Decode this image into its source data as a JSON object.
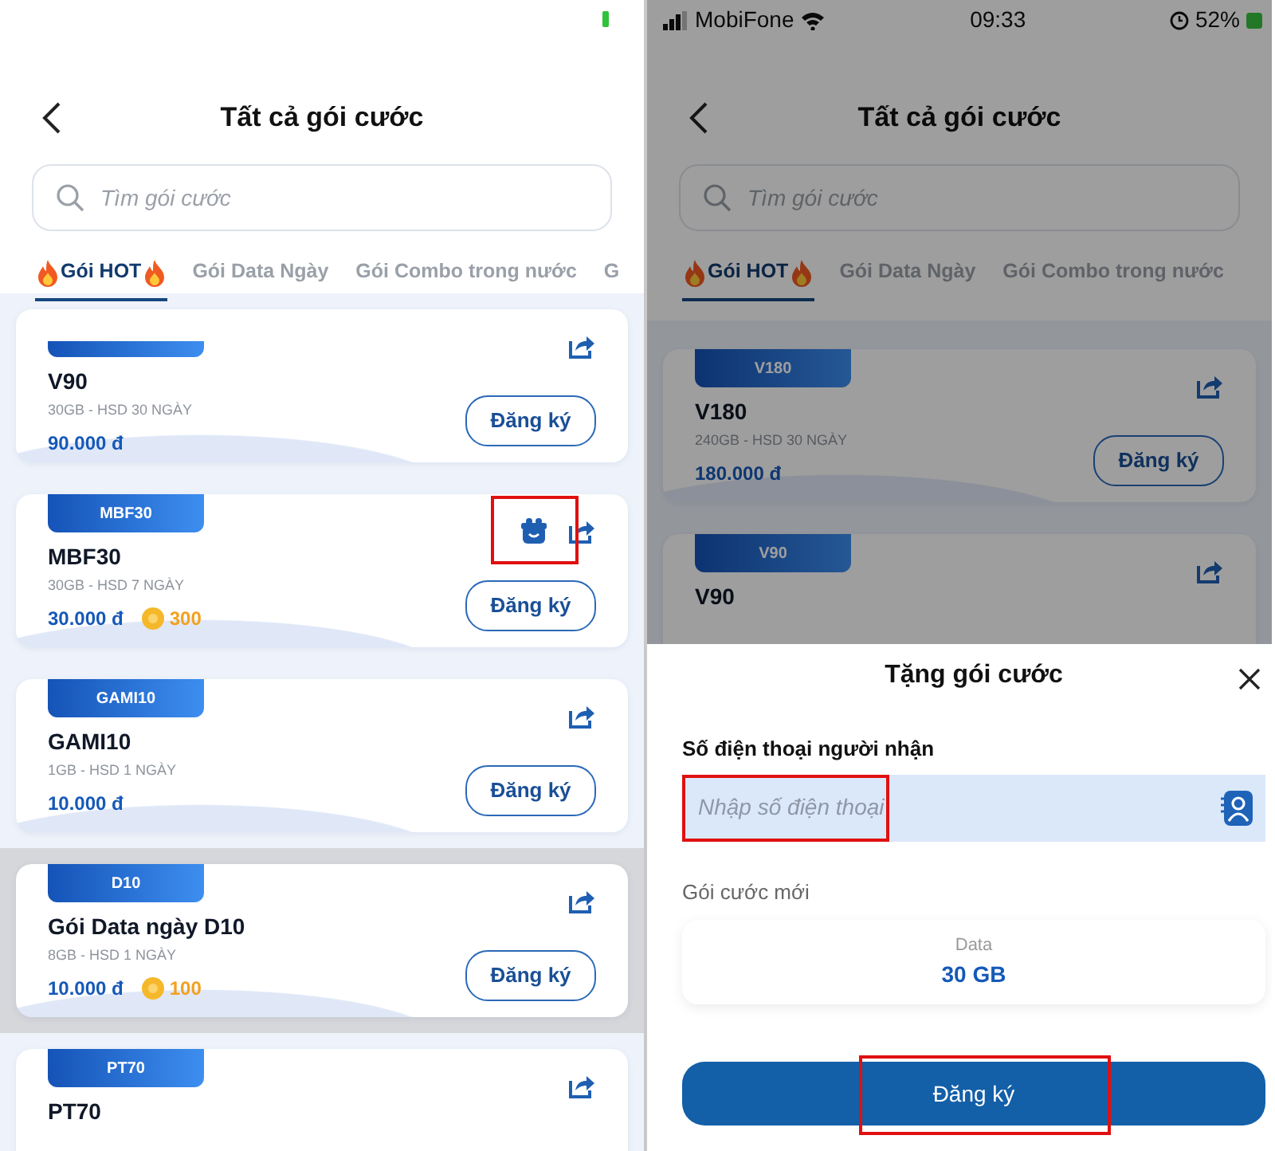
{
  "left_screen": {
    "title": "Tất cả gói cước",
    "search": {
      "placeholder": "Tìm gói cước"
    },
    "tabs": [
      {
        "label": "Gói HOT",
        "hot": true,
        "selected": true
      },
      {
        "label": "Gói Data Ngày",
        "selected": false
      },
      {
        "label": "Gói Combo trong nước",
        "selected": false
      },
      {
        "label": "G",
        "selected": false
      }
    ],
    "cards": [
      {
        "name": "V90",
        "details": "30GB - HSD 30 NGÀY",
        "price": "90.000 đ",
        "button": "Đăng ký",
        "pressed": false
      },
      {
        "badge": "MBF30",
        "name": "MBF30",
        "details": "30GB - HSD 7 NGÀY",
        "price": "30.000 đ",
        "points": "300",
        "gift": {
          "annotated": true
        },
        "button": "Đăng ký",
        "pressed": false
      },
      {
        "badge": "GAMI10",
        "name": "GAMI10",
        "details": "1GB - HSD 1 NGÀY",
        "price": "10.000 đ",
        "button": "Đăng ký",
        "pressed": false
      },
      {
        "badge": "D10",
        "name": "Gói Data ngày D10",
        "details": "8GB - HSD 1 NGÀY",
        "price": "10.000 đ",
        "points": "100",
        "button": "Đăng ký",
        "pressed": true
      },
      {
        "badge": "PT70",
        "name": "PT70",
        "pressed": false
      }
    ]
  },
  "right_screen": {
    "dimmed": true,
    "status_bar": {
      "carrier": "MobiFone",
      "time": "09:33",
      "battery": "52%"
    },
    "title": "Tất cả gói cước",
    "search": {
      "placeholder": "Tìm gói cước"
    },
    "tabs": [
      {
        "label": "Gói HOT",
        "hot": true,
        "selected": true
      },
      {
        "label": "Gói Data Ngày",
        "selected": false
      },
      {
        "label": "Gói Combo trong nước",
        "selected": false
      }
    ],
    "cards": [
      {
        "badge": "V180",
        "name": "V180",
        "details": "240GB - HSD 30 NGÀY",
        "price": "180.000 đ",
        "button": "Đăng ký",
        "pressed": false
      },
      {
        "badge": "V90",
        "name": "V90",
        "pressed": false
      }
    ],
    "sheet": {
      "title": "Tặng gói cước",
      "phone_label": "Số điện thoại người nhận",
      "phone_placeholder": "Nhập số điện thoại",
      "phone_annotated": true,
      "package_label": "Gói cước mới",
      "package": {
        "label": "Data",
        "value": "30 GB"
      },
      "submit": "Đăng ký",
      "submit_annotated": true
    }
  }
}
